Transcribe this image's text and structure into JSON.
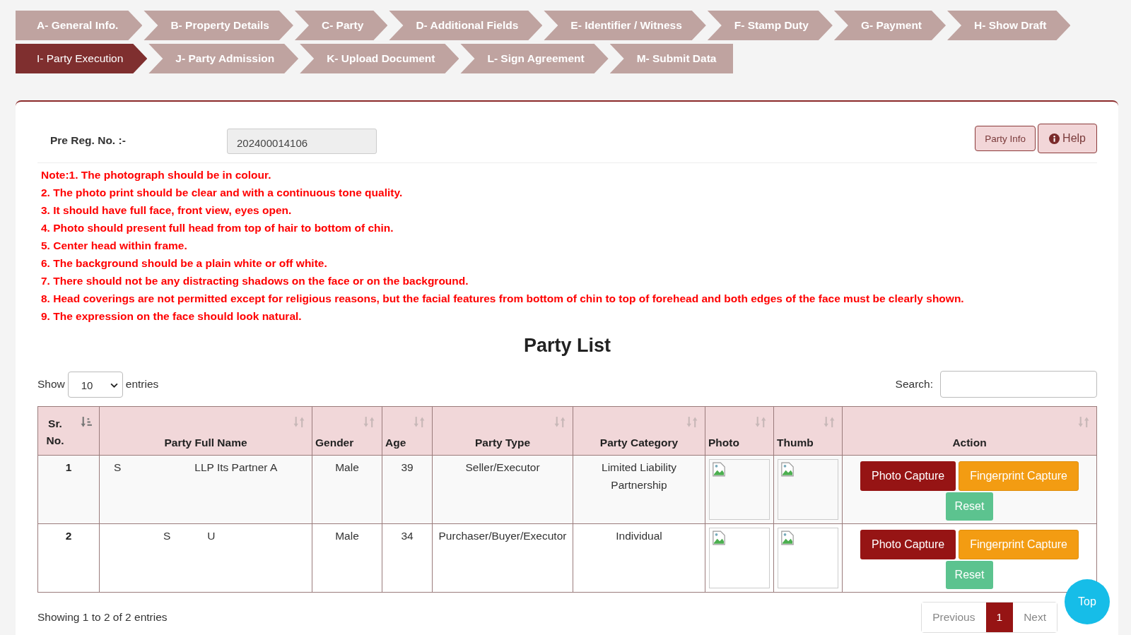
{
  "steps": [
    {
      "label": "A- General Info.",
      "selected": false
    },
    {
      "label": "B- Property Details",
      "selected": false
    },
    {
      "label": "C- Party",
      "selected": false
    },
    {
      "label": "D- Additional Fields",
      "selected": false
    },
    {
      "label": "E- Identifier / Witness",
      "selected": false
    },
    {
      "label": "F- Stamp Duty",
      "selected": false
    },
    {
      "label": "G- Payment",
      "selected": false
    },
    {
      "label": "H- Show Draft",
      "selected": false
    },
    {
      "label": "I- Party Execution",
      "selected": true
    },
    {
      "label": "J- Party Admission",
      "selected": false
    },
    {
      "label": "K- Upload Document",
      "selected": false
    },
    {
      "label": "L- Sign Agreement",
      "selected": false
    },
    {
      "label": "M- Submit Data",
      "selected": false
    }
  ],
  "pre_reg": {
    "label": "Pre Reg. No. :-",
    "value": "202400014106"
  },
  "header_buttons": {
    "party_info": "Party Info",
    "help": "Help"
  },
  "notes": [
    "Note:1. The photograph should be in colour.",
    "2. The photo print should be clear and with a continuous tone quality.",
    "3. It should have full face, front view, eyes open.",
    "4. Photo should present full head from top of hair to bottom of chin.",
    "5. Center head within frame.",
    "6. The background should be a plain white or off white.",
    "7. There should not be any distracting shadows on the face or on the background.",
    "8. Head coverings are not permitted except for religious reasons, but the facial features from bottom of chin to top of forehead and both edges of the face must be clearly shown.",
    "9. The expression on the face should look natural."
  ],
  "list_title": "Party List",
  "length_menu": {
    "show": "Show",
    "value": "10",
    "entries": "entries"
  },
  "search": {
    "label": "Search:"
  },
  "table": {
    "columns": [
      {
        "label": "Sr. No.",
        "sorted": true
      },
      {
        "label": "Party Full Name",
        "sorted": false
      },
      {
        "label": "Gender",
        "sorted": false
      },
      {
        "label": "Age",
        "sorted": false
      },
      {
        "label": "Party Type",
        "sorted": false
      },
      {
        "label": "Party Category",
        "sorted": false
      },
      {
        "label": "Photo",
        "sorted": false
      },
      {
        "label": "Thumb",
        "sorted": false
      },
      {
        "label": "Action",
        "sorted": false
      }
    ],
    "rows": [
      {
        "sr": "1",
        "name_parts": [
          "S",
          "LLP Its Partner A"
        ],
        "gender": "Male",
        "age": "39",
        "party_type": "Seller/Executor",
        "party_category": "Limited Liability Partnership",
        "buttons": [
          "Photo Capture",
          "Fingerprint Capture",
          "Reset"
        ]
      },
      {
        "sr": "2",
        "name_parts": [
          "S",
          "U"
        ],
        "gender": "Male",
        "age": "34",
        "party_type": "Purchaser/Buyer/Executor",
        "party_category": "Individual",
        "buttons": [
          "Photo Capture",
          "Fingerprint Capture",
          "Reset"
        ]
      }
    ]
  },
  "info": "Showing 1 to 2 of 2 entries",
  "pagination": [
    {
      "label": "Previous",
      "selected": false
    },
    {
      "label": "1",
      "selected": true
    },
    {
      "label": "Next",
      "selected": false
    }
  ],
  "top_button": "Top"
}
